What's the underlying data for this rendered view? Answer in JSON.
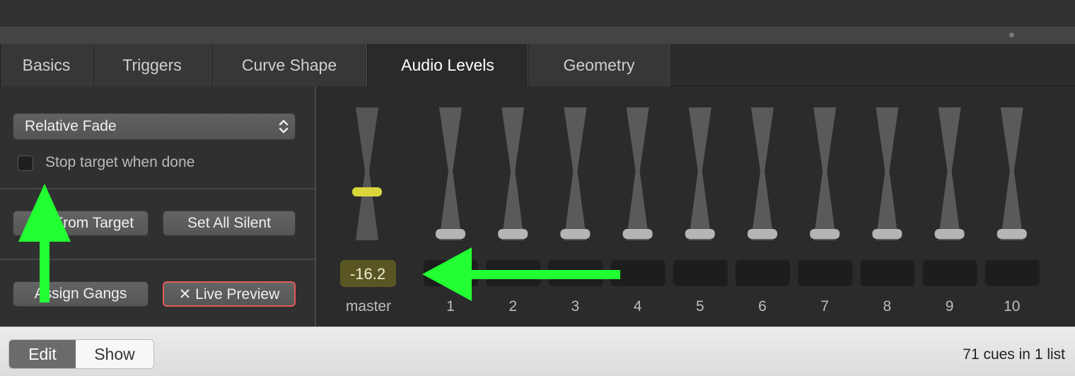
{
  "tabs": [
    {
      "label": "Basics",
      "active": false
    },
    {
      "label": "Triggers",
      "active": false
    },
    {
      "label": "Curve Shape",
      "active": false
    },
    {
      "label": "Audio Levels",
      "active": true
    },
    {
      "label": "Geometry",
      "active": false
    }
  ],
  "left": {
    "fade_mode": "Relative Fade",
    "stop_target_label": "Stop target when done",
    "stop_target_checked": false,
    "set_from_target_label": "Set From Target",
    "set_all_silent_label": "Set All Silent",
    "assign_gangs_label": "Assign Gangs",
    "live_preview_label": "✕ Live Preview"
  },
  "faders": {
    "master": {
      "label": "master",
      "value": "-16.2",
      "accent": "#d9d63c"
    },
    "channels": [
      {
        "label": "1",
        "value": ""
      },
      {
        "label": "2",
        "value": ""
      },
      {
        "label": "3",
        "value": ""
      },
      {
        "label": "4",
        "value": ""
      },
      {
        "label": "5",
        "value": ""
      },
      {
        "label": "6",
        "value": ""
      },
      {
        "label": "7",
        "value": ""
      },
      {
        "label": "8",
        "value": ""
      },
      {
        "label": "9",
        "value": ""
      },
      {
        "label": "10",
        "value": ""
      }
    ]
  },
  "bottom": {
    "edit_label": "Edit",
    "show_label": "Show",
    "status": "71 cues in 1 list"
  },
  "colors": {
    "annotation_arrow": "#22ff33",
    "live_preview_border": "#e45a5a"
  }
}
